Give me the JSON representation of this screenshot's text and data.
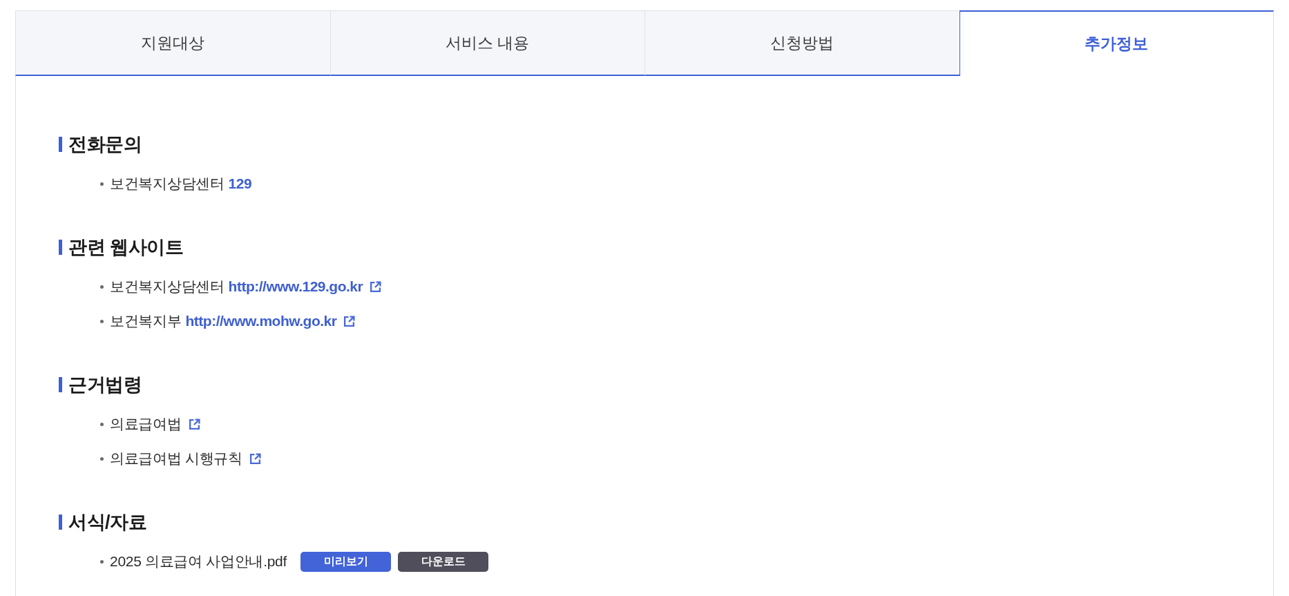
{
  "tabs": [
    {
      "label": "지원대상",
      "selected": false
    },
    {
      "label": "서비스 내용",
      "selected": false
    },
    {
      "label": "신청방법",
      "selected": false
    },
    {
      "label": "추가정보",
      "selected": true
    }
  ],
  "sections": [
    {
      "title": "전화문의",
      "items": [
        {
          "text": "보건복지상담센터",
          "link": "129",
          "external": false
        }
      ]
    },
    {
      "title": "관련 웹사이트",
      "items": [
        {
          "text": "보건복지상담센터",
          "link": "http://www.129.go.kr",
          "external": true
        },
        {
          "text": "보건복지부",
          "link": "http://www.mohw.go.kr",
          "external": true
        }
      ]
    },
    {
      "title": "근거법령",
      "items": [
        {
          "text": "의료급여법",
          "external": true
        },
        {
          "text": "의료급여법 시행규칙",
          "external": true
        }
      ]
    },
    {
      "title": "서식/자료",
      "items": [
        {
          "text": "2025 의료급여 사업안내.pdf",
          "external": false,
          "buttons": [
            {
              "label": "미리보기",
              "kind": "preview"
            },
            {
              "label": "다운로드",
              "kind": "download"
            }
          ]
        }
      ]
    }
  ]
}
